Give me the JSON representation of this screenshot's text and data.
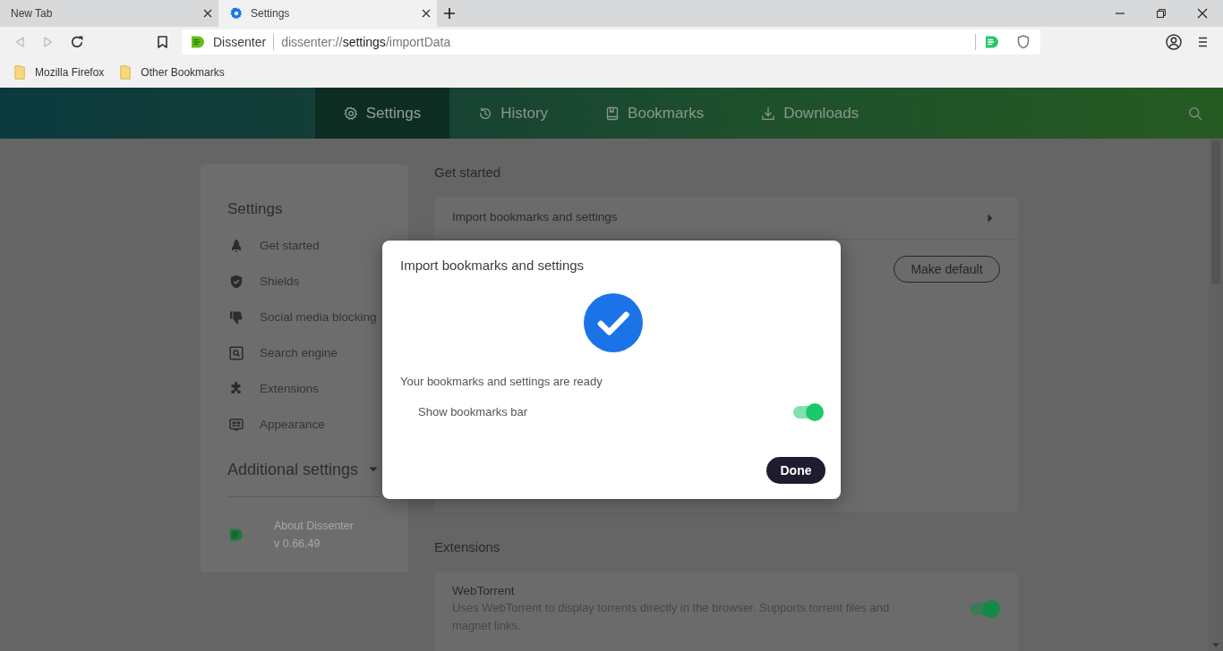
{
  "browser": {
    "tabs": [
      {
        "title": "New Tab",
        "selected": false
      },
      {
        "title": "Settings",
        "selected": true
      }
    ],
    "navigation": {
      "back_enabled": false,
      "forward_enabled": false
    },
    "address_bar": {
      "site_name": "Dissenter",
      "url": "dissenter://**settings**/importData"
    },
    "bookmarks": [
      {
        "label": "Mozilla Firefox"
      },
      {
        "label": "Other Bookmarks"
      }
    ]
  },
  "top_nav": [
    {
      "label": "Settings",
      "selected": true
    },
    {
      "label": "History",
      "selected": false
    },
    {
      "label": "Bookmarks",
      "selected": false
    },
    {
      "label": "Downloads",
      "selected": false
    }
  ],
  "sidebar": {
    "title": "Settings",
    "items": [
      {
        "label": "Get started",
        "selected": false
      },
      {
        "label": "Shields",
        "selected": false
      },
      {
        "label": "Social media blocking",
        "selected": false
      },
      {
        "label": "Search engine",
        "selected": false
      },
      {
        "label": "Extensions",
        "selected": false
      },
      {
        "label": "Appearance",
        "selected": false
      }
    ],
    "additional_settings": {
      "label": "Additional settings",
      "expanded": false
    },
    "about": {
      "label": "About Dissenter",
      "version": "v 0.66.49"
    }
  },
  "sections": [
    {
      "title": "Get started",
      "rows": [
        {
          "kind": "link",
          "label": "Import bookmarks and settings"
        },
        {
          "kind": "button",
          "button": "Make default"
        }
      ]
    },
    {
      "title": "Extensions",
      "rows": [
        {
          "kind": "toggle",
          "label": "WebTorrent",
          "description": "Uses WebTorrent to display torrents directly in the browser. Supports torrent files and magnet links.",
          "on": true
        }
      ]
    }
  ],
  "dialog": {
    "title": "Import bookmarks and settings",
    "message": "Your bookmarks and settings are ready",
    "option": {
      "label": "Show bookmarks bar",
      "on": true
    },
    "button": "Done"
  }
}
